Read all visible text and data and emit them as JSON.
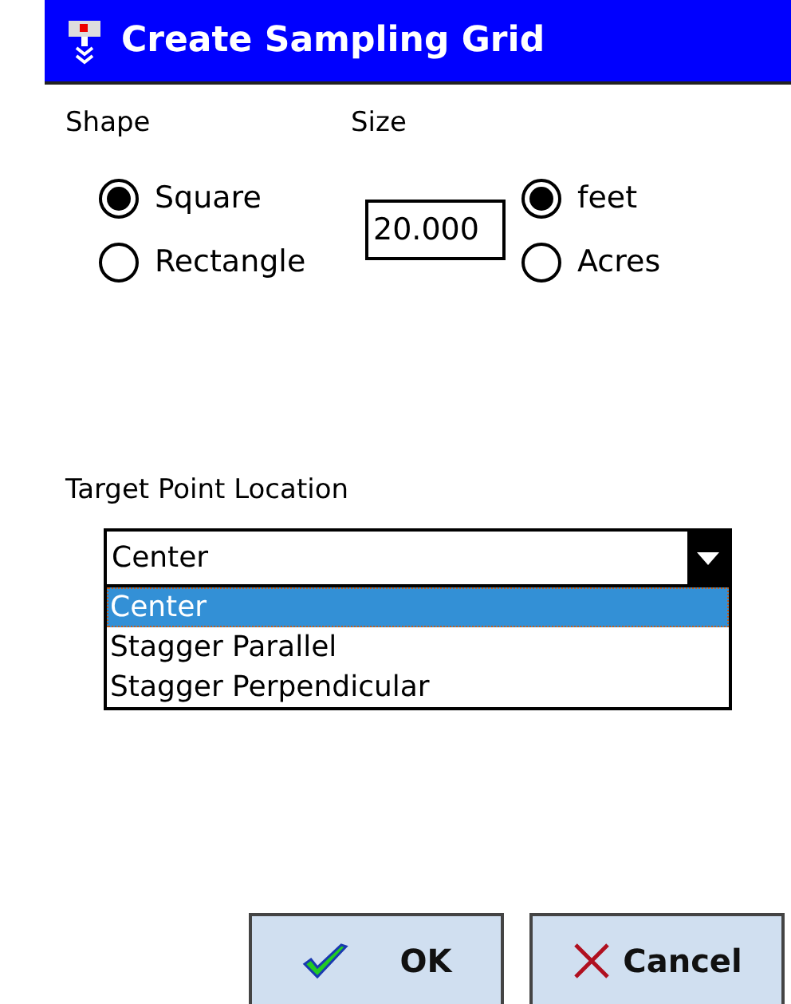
{
  "window": {
    "title": "Create Sampling Grid"
  },
  "shape": {
    "label": "Shape",
    "options": [
      {
        "label": "Square",
        "selected": true
      },
      {
        "label": "Rectangle",
        "selected": false
      }
    ]
  },
  "size": {
    "label": "Size",
    "value": "20.000",
    "units": [
      {
        "label": "feet",
        "selected": true
      },
      {
        "label": "Acres",
        "selected": false
      }
    ]
  },
  "target": {
    "label": "Target Point Location",
    "value": "Center",
    "expanded": true,
    "options": [
      {
        "label": "Center",
        "selected": true
      },
      {
        "label": "Stagger Parallel",
        "selected": false
      },
      {
        "label": "Stagger Perpendicular",
        "selected": false
      }
    ]
  },
  "buttons": [
    {
      "label": "OK",
      "kind": "ok"
    },
    {
      "label": "Cancel",
      "kind": "cancel"
    }
  ]
}
